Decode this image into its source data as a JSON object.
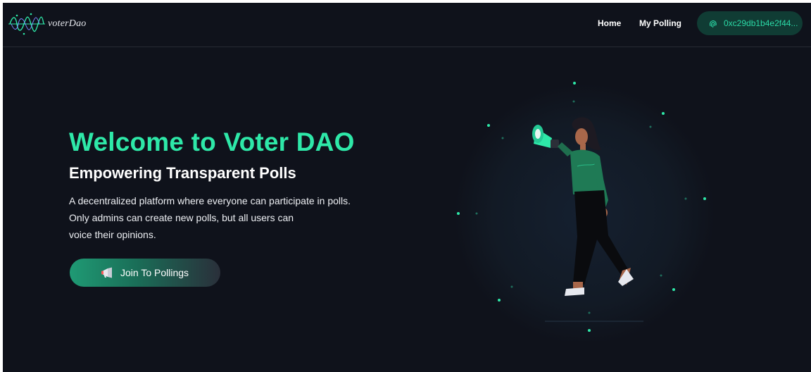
{
  "brand": {
    "logo_text_italic": "voter",
    "logo_text_rest": "Dao"
  },
  "nav": {
    "home": "Home",
    "my_polling": "My Polling",
    "wallet_address": "0xc29db1b4e2f44..."
  },
  "hero": {
    "title": "Welcome to Voter DAO",
    "subtitle": "Empowering Transparent Polls",
    "description_lines": [
      "A decentralized platform where everyone can participate in polls.",
      "Only admins can create new polls, but all users can",
      "voice their opinions."
    ],
    "cta_label": "Join To Pollings"
  },
  "icons": {
    "logo": "waveform-logo-icon",
    "wallet": "fingerprint-icon",
    "cta": "megaphone-icon",
    "illustration": "woman-with-megaphone-illustration"
  },
  "colors": {
    "background": "#0f121b",
    "accent": "#2ee8a8",
    "wallet_bg": "#103c34",
    "wallet_text": "#2bd9a6"
  }
}
